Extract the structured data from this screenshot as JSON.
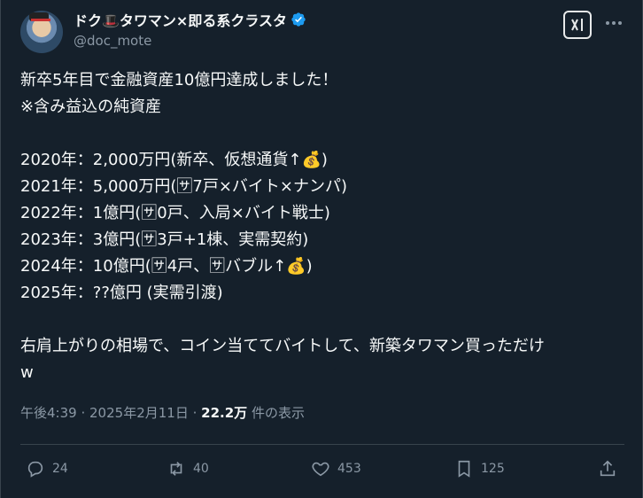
{
  "author": {
    "display_name": "ドク🎩タワマン×即る系クラスタ",
    "handle": "@doc_mote",
    "verified": true,
    "avatar_icon": "avatar-icon"
  },
  "header_actions": {
    "grok_icon": "grok-icon",
    "more_icon": "more-icon"
  },
  "tweet": {
    "lines": [
      "新卒5年目で金融資産10億円達成しました！",
      "※含み益込の純資産",
      "",
      "2020年：2,000万円(新卒、仮想通貨↑💰)",
      "2021年：5,000万円(🈂7戸×バイト×ナンパ)",
      "2022年：1億円(🈂0戸、入局×バイト戦士)",
      "2023年：3億円(🈂3戸+1棟、実需契約)",
      "2024年：10億円(🈂4戸、🈂バブル↑💰)",
      "2025年：??億円  (実需引渡)",
      "",
      "右肩上がりの相場で、コイン当ててバイトして、新築タワマン買っただけ",
      "w"
    ]
  },
  "meta": {
    "time": "午後4:39",
    "date": "2025年2月11日",
    "views_count": "22.2万",
    "views_label": "件の表示"
  },
  "actions": {
    "reply_count": "24",
    "retweet_count": "40",
    "like_count": "453",
    "bookmark_count": "125"
  },
  "colors": {
    "background": "#15202b",
    "text": "#f7f9f9",
    "secondary": "#8b98a5",
    "verified": "#1d9bf0"
  }
}
